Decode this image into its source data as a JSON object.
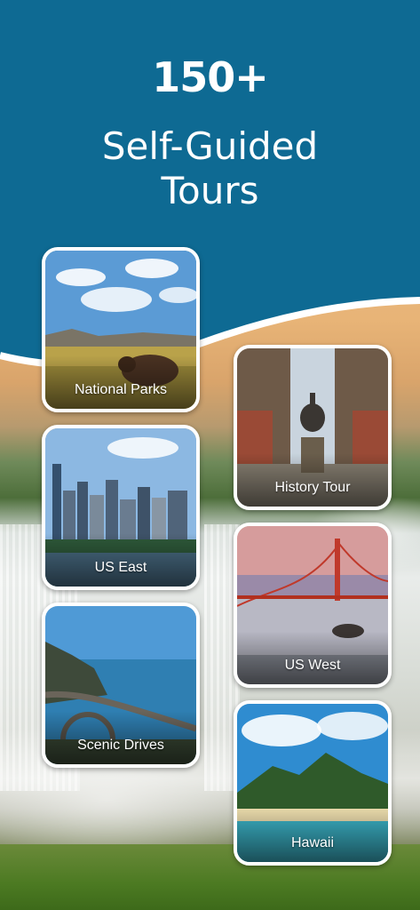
{
  "header": {
    "count": "150+",
    "subtitle_line1": "Self-Guided",
    "subtitle_line2": "Tours"
  },
  "colors": {
    "header_blue": "#0e6a93",
    "card_border": "#ffffff",
    "label_text": "#ffffff"
  },
  "tour_categories": [
    {
      "label": "National Parks",
      "scene": "bison-prairie-image"
    },
    {
      "label": "History Tour",
      "scene": "statue-park-image"
    },
    {
      "label": "US East",
      "scene": "city-skyline-image"
    },
    {
      "label": "US West",
      "scene": "golden-gate-bridge-image"
    },
    {
      "label": "Scenic Drives",
      "scene": "coastal-bridge-image"
    },
    {
      "label": "Hawaii",
      "scene": "tropical-island-image"
    }
  ]
}
